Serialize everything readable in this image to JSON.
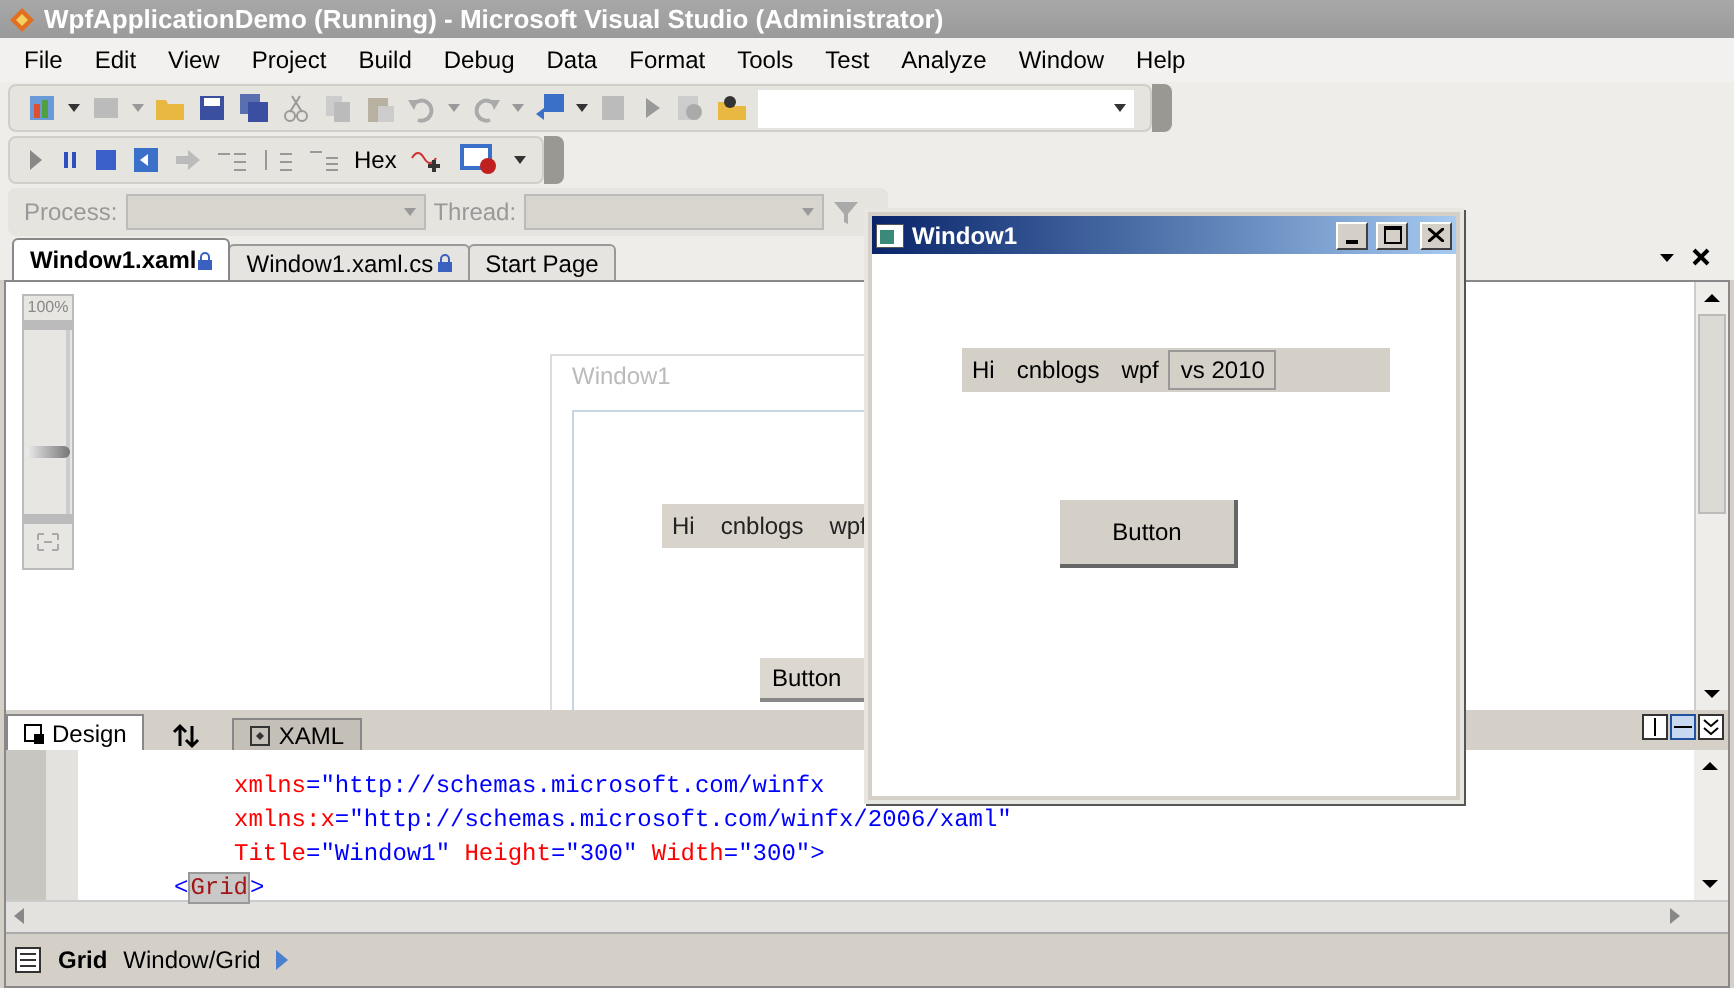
{
  "window": {
    "title": "WpfApplicationDemo (Running) - Microsoft Visual Studio (Administrator)"
  },
  "menu": [
    "File",
    "Edit",
    "View",
    "Project",
    "Build",
    "Debug",
    "Data",
    "Format",
    "Tools",
    "Test",
    "Analyze",
    "Window",
    "Help"
  ],
  "debug_toolbar": {
    "hex_label": "Hex"
  },
  "location_toolbar": {
    "process_label": "Process:",
    "thread_label": "Thread:"
  },
  "tabs": [
    {
      "label": "Window1.xaml",
      "selected": true,
      "locked": true
    },
    {
      "label": "Window1.xaml.cs",
      "selected": false,
      "locked": true
    },
    {
      "label": "Start Page",
      "selected": false,
      "locked": false
    }
  ],
  "designer": {
    "zoom_label": "100%",
    "level": 0.33,
    "preview": {
      "title": "Window1",
      "items": [
        "Hi",
        "cnblogs",
        "wpf"
      ],
      "button": "Button"
    }
  },
  "view_tabs": [
    {
      "label": "Design",
      "selected": true,
      "kind": "design"
    },
    {
      "label": "XAML",
      "selected": false,
      "kind": "xaml"
    }
  ],
  "code_lines": [
    {
      "kind": "attribute",
      "tokens": [
        {
          "kind": "attr",
          "text": "xmlns"
        },
        {
          "kind": "punct",
          "text": "="
        },
        {
          "kind": "value",
          "text": "\"http://schemas.microsoft.com/winfx"
        }
      ]
    },
    {
      "kind": "attribute",
      "tokens": [
        {
          "kind": "attr",
          "text": "xmlns:x"
        },
        {
          "kind": "punct",
          "text": "="
        },
        {
          "kind": "value",
          "text": "\"http://schemas.microsoft.com/winfx/2006/xaml\""
        }
      ]
    },
    {
      "kind": "attribute",
      "tokens": [
        {
          "kind": "attr",
          "text": "Title"
        },
        {
          "kind": "punct",
          "text": "="
        },
        {
          "kind": "value",
          "text": "\"Window1\" "
        },
        {
          "kind": "attr",
          "text": "Height"
        },
        {
          "kind": "punct",
          "text": "="
        },
        {
          "kind": "value",
          "text": "\"300\" "
        },
        {
          "kind": "attr",
          "text": "Width"
        },
        {
          "kind": "punct",
          "text": "="
        },
        {
          "kind": "value",
          "text": "\"300\">"
        }
      ]
    },
    {
      "kind": "element",
      "tokens": [
        {
          "kind": "punct",
          "text": "<"
        },
        {
          "kind": "tag",
          "text": "Grid",
          "highlighted": true
        },
        {
          "kind": "punct",
          "text": ">"
        }
      ]
    }
  ],
  "breadcrumb": {
    "element": "Grid",
    "path": "Window/Grid"
  },
  "running_window": {
    "title": "Window1",
    "items": [
      {
        "text": "Hi",
        "kind": "label"
      },
      {
        "text": "cnblogs",
        "kind": "label"
      },
      {
        "text": "wpf",
        "kind": "label"
      },
      {
        "text": "vs 2010",
        "kind": "button"
      }
    ],
    "button": "Button"
  }
}
